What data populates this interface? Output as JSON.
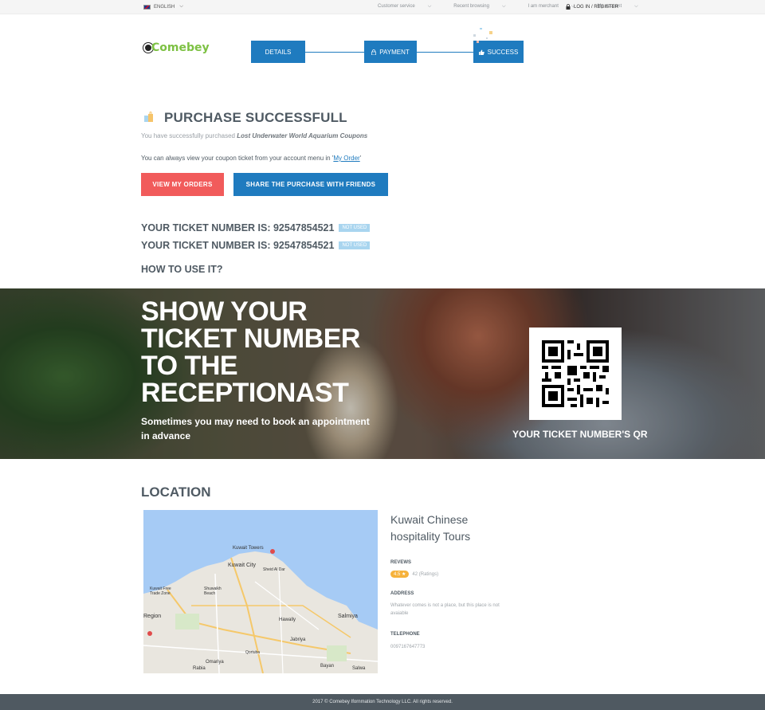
{
  "topbar": {
    "language": "ENGLISH",
    "menu": [
      "Customer service",
      "Recent browsing",
      "I am merchant",
      "My account"
    ],
    "login": "LOG IN / REGISTER"
  },
  "header": {
    "logo_text": "Comebey",
    "steps": [
      {
        "label": "DETAILS",
        "icon": ""
      },
      {
        "label": "PAYMENT",
        "icon": "lock-icon"
      },
      {
        "label": "SUCCESS",
        "icon": "thumbs-up-icon"
      }
    ]
  },
  "success": {
    "title": "PURCHASE SUCCESSFULL",
    "subtitle_prefix": "You have successfully purchased",
    "product": "Lost Underwater World Aquarium Coupons",
    "account_note_prefix": "You can always view your coupon ticket from  your account menu in '",
    "account_note_link": "My Order",
    "account_note_suffix": "'",
    "view_orders_button": "VIEW MY ORDERS",
    "share_button": "SHARE THE PURCHASE WITH FRIENDS",
    "tickets": [
      {
        "label": "YOUR TICKET NUMBER IS: 92547854521",
        "status": "NOT USED"
      },
      {
        "label": "YOUR TICKET NUMBER IS: 92547854521",
        "status": "NOT USED"
      }
    ],
    "howto_title": "HOW TO USE IT?"
  },
  "hero": {
    "title": "SHOW YOUR TICKET NUMBER TO THE RECEPTIONAST",
    "subtitle": "Sometimes you may need to book an appointment in advance",
    "qr_label": "YOUR TICKET NUMBER'S QR"
  },
  "location": {
    "title": "LOCATION",
    "place_name": "Kuwait Chinese hospitality Tours",
    "reviews_label": "REVEWS",
    "rating_score": "4.5 ★",
    "rating_count": "42 (Ratings)",
    "address_label": "ADDRESS",
    "address_value": "Whatever comes is not a place, but this place is not avaiable",
    "telephone_label": "TELEPHONE",
    "telephone_value": "0097167647773",
    "map_labels": [
      "Kuwait Towers",
      "Kuwait City",
      "Shuwaikh Beach",
      "Kuwait Free Trade Zone",
      "Salmiya",
      "Hawally",
      "Jabriya",
      "Bayan",
      "Salwa",
      "Qortuba",
      "Region",
      "Rabia",
      "Omariya",
      "Sheid Al Dar"
    ]
  },
  "footer": {
    "text": "2017 © Comebey Ifornmation Technology LLC. All rights reserved."
  },
  "colors": {
    "primary": "#1f7bbf",
    "accent_red": "#f15b5b",
    "badge": "#a9d5ef",
    "footer_bg": "#4f5961"
  }
}
